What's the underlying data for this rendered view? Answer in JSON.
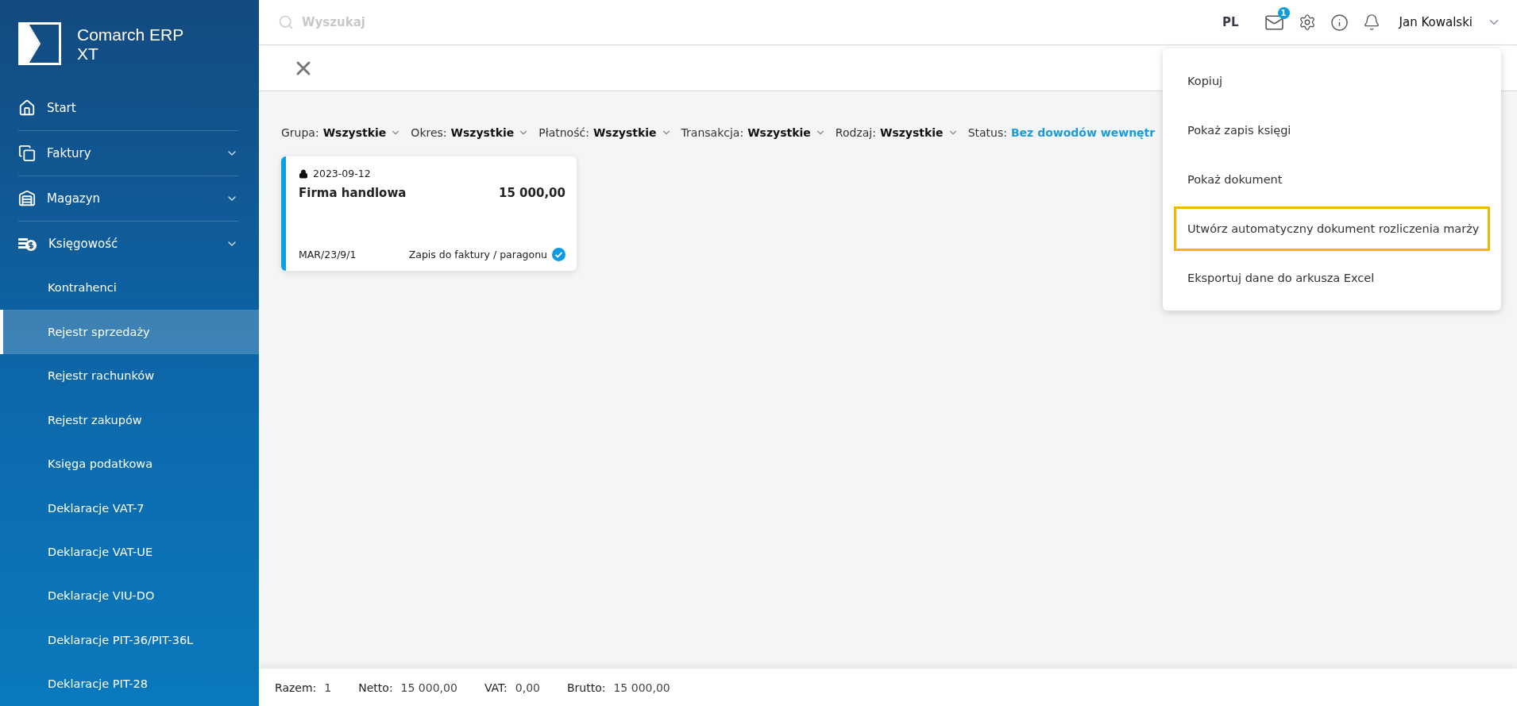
{
  "sidebar": {
    "logo_text": "Comarch ERP XT",
    "items": [
      {
        "label": "Start",
        "expandable": false
      },
      {
        "label": "Faktury",
        "expandable": true
      },
      {
        "label": "Magazyn",
        "expandable": true
      },
      {
        "label": "Księgowość",
        "expandable": true,
        "children": [
          {
            "label": "Kontrahenci",
            "selected": false
          },
          {
            "label": "Rejestr sprzedaży",
            "selected": true
          },
          {
            "label": "Rejestr rachunków",
            "selected": false
          },
          {
            "label": "Rejestr zakupów",
            "selected": false
          },
          {
            "label": "Księga podatkowa",
            "selected": false
          },
          {
            "label": "Deklaracje VAT-7",
            "selected": false
          },
          {
            "label": "Deklaracje VAT-UE",
            "selected": false
          },
          {
            "label": "Deklaracje VIU-DO",
            "selected": false
          },
          {
            "label": "Deklaracje PIT-36/PIT-36L",
            "selected": false
          },
          {
            "label": "Deklaracje PIT-28",
            "selected": false
          }
        ]
      }
    ]
  },
  "header": {
    "search": {
      "placeholder": "Wyszukaj"
    },
    "language": "PL",
    "mail_badge": "1",
    "user": "Jan Kowalski"
  },
  "filters": [
    {
      "label": "Grupa:",
      "value": "Wszystkie",
      "kind": "dropdown"
    },
    {
      "label": "Okres:",
      "value": "Wszystkie",
      "kind": "dropdown"
    },
    {
      "label": "Płatność:",
      "value": "Wszystkie",
      "kind": "dropdown"
    },
    {
      "label": "Transakcja:",
      "value": "Wszystkie",
      "kind": "dropdown"
    },
    {
      "label": "Rodzaj:",
      "value": "Wszystkie",
      "kind": "dropdown"
    },
    {
      "label": "Status:",
      "value": "Bez dowodów wewnętr",
      "kind": "link"
    }
  ],
  "cards": [
    {
      "date": "2023-09-12",
      "name": "Firma handlowa",
      "amount": "15 000,00",
      "number": "MAR/23/9/1",
      "status": "Zapis do faktury / paragonu",
      "locked": true,
      "confirmed": true
    }
  ],
  "menu": {
    "items": [
      {
        "label": "Kopiuj",
        "highlighted": false
      },
      {
        "label": "Pokaż zapis księgi",
        "highlighted": false
      },
      {
        "label": "Pokaż dokument",
        "highlighted": false
      },
      {
        "label": "Utwórz automatyczny dokument rozliczenia marży",
        "highlighted": true
      },
      {
        "label": "Eksportuj dane do arkusza Excel",
        "highlighted": false
      }
    ]
  },
  "summary": [
    {
      "label": "Razem:",
      "value": "1"
    },
    {
      "label": "Netto:",
      "value": "15 000,00"
    },
    {
      "label": "VAT:",
      "value": "0,00"
    },
    {
      "label": "Brutto:",
      "value": "15 000,00"
    }
  ]
}
